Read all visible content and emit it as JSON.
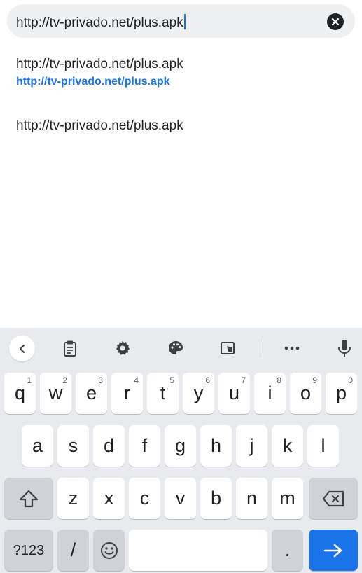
{
  "url_bar": {
    "text": "http://tv-privado.net/plus.apk",
    "clear_icon": "close-circle-icon"
  },
  "suggestions": [
    {
      "title": "http://tv-privado.net/plus.apk",
      "url": "http://tv-privado.net/plus.apk"
    },
    {
      "title": "http://tv-privado.net/plus.apk"
    }
  ],
  "keyboard": {
    "toolbar": {
      "icons": [
        "chevron-left-icon",
        "clipboard-icon",
        "gear-icon",
        "palette-icon",
        "resize-icon",
        "more-horiz-icon",
        "microphone-icon"
      ]
    },
    "row1": [
      {
        "key": "q",
        "hint": "1"
      },
      {
        "key": "w",
        "hint": "2"
      },
      {
        "key": "e",
        "hint": "3"
      },
      {
        "key": "r",
        "hint": "4"
      },
      {
        "key": "t",
        "hint": "5"
      },
      {
        "key": "y",
        "hint": "6"
      },
      {
        "key": "u",
        "hint": "7"
      },
      {
        "key": "i",
        "hint": "8"
      },
      {
        "key": "o",
        "hint": "9"
      },
      {
        "key": "p",
        "hint": "0"
      }
    ],
    "row2": [
      "a",
      "s",
      "d",
      "f",
      "g",
      "h",
      "j",
      "k",
      "l"
    ],
    "row3": [
      "z",
      "x",
      "c",
      "v",
      "b",
      "n",
      "m"
    ],
    "row4": {
      "symbols": "?123",
      "slash": "/",
      "emoji": "emoji-icon",
      "space": "",
      "period": ".",
      "enter": "arrow-right-icon"
    },
    "colors": {
      "background": "#e8eaed",
      "key": "#ffffff",
      "dark_key": "#cfd2d6",
      "accent": "#1a73e8"
    }
  }
}
